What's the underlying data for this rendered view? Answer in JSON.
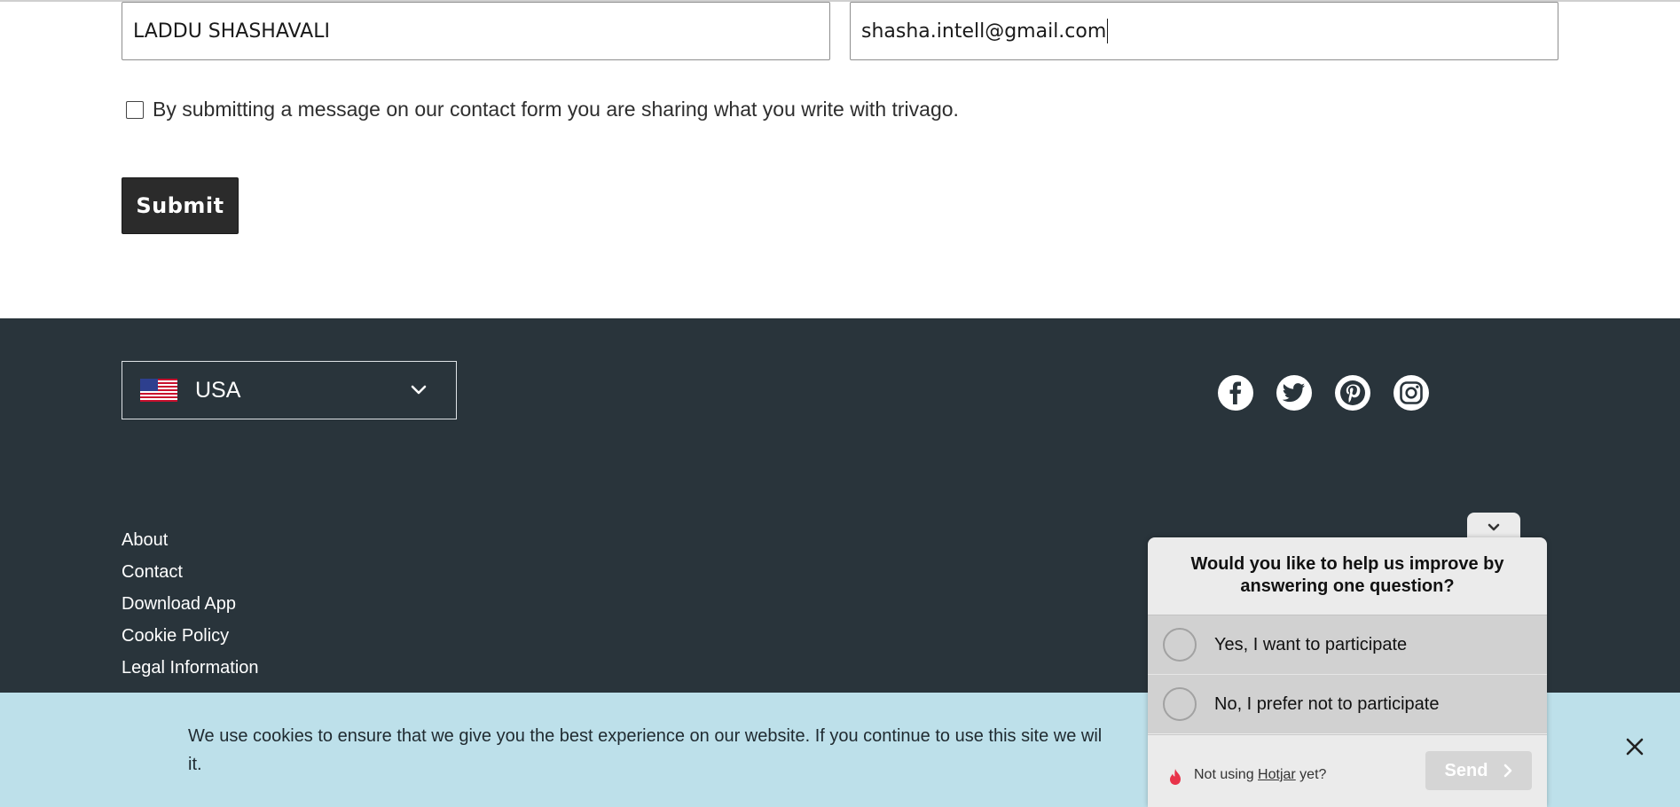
{
  "form": {
    "name_value": "LADDU SHASHAVALI",
    "email_value": "shasha.intell@gmail.com",
    "consent_label": "By submitting a message on our contact form you are sharing what you write with trivago.",
    "submit_label": "Submit"
  },
  "footer": {
    "country": {
      "label": "USA",
      "flag_icon": "us-flag-icon"
    },
    "social_icons": [
      "facebook-icon",
      "twitter-icon",
      "pinterest-icon",
      "instagram-icon"
    ],
    "links": [
      "About",
      "Contact",
      "Download App",
      "Cookie Policy",
      "Legal Information"
    ]
  },
  "cookie_banner": {
    "text": "We use cookies to ensure that we give you the best experience on our website. If you continue to use this site we wil",
    "text_line2": "it."
  },
  "survey": {
    "question": "Would you like to help us improve by answering one question?",
    "options": [
      "Yes, I want to participate",
      "No, I prefer not to participate"
    ],
    "note_prefix": "Not using ",
    "note_link": "Hotjar",
    "note_suffix": " yet?",
    "send_label": "Send"
  },
  "colors": {
    "footer_bg": "#29343b",
    "submit_bg": "#2b2b2b",
    "cookie_bg": "#bde0ea",
    "widget_bg": "#ebebeb",
    "option_bg": "#d1d1d1",
    "flame": "#e8334a"
  }
}
